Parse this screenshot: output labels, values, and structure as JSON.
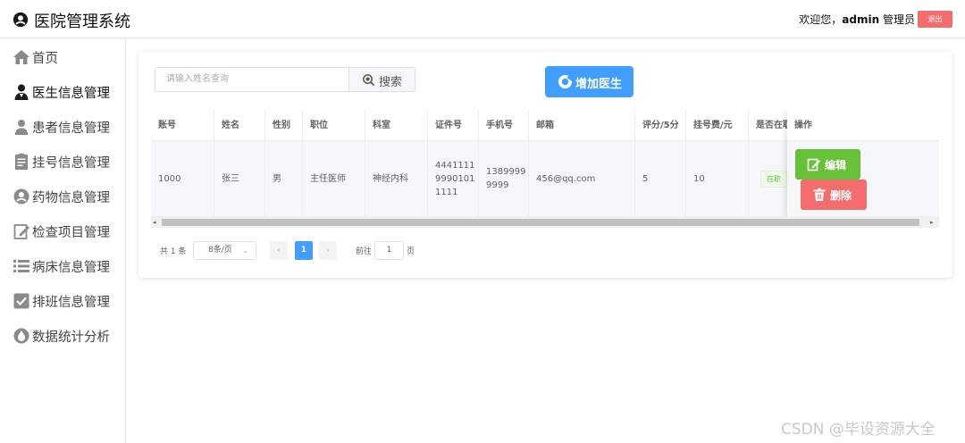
{
  "header": {
    "app_title": "医院管理系统",
    "welcome_prefix": "欢迎您，",
    "username": "admin",
    "role": "管理员",
    "logout_label": "退出"
  },
  "sidebar": {
    "items": [
      {
        "label": "首页",
        "icon": "home-icon"
      },
      {
        "label": "医生信息管理",
        "icon": "doctor-icon"
      },
      {
        "label": "患者信息管理",
        "icon": "patient-icon"
      },
      {
        "label": "挂号信息管理",
        "icon": "registration-icon"
      },
      {
        "label": "药物信息管理",
        "icon": "medicine-icon"
      },
      {
        "label": "检查项目管理",
        "icon": "checkup-icon"
      },
      {
        "label": "病床信息管理",
        "icon": "bed-list-icon"
      },
      {
        "label": "排班信息管理",
        "icon": "schedule-check-icon"
      },
      {
        "label": "数据统计分析",
        "icon": "statistics-icon"
      }
    ],
    "active_item": "医生信息管理"
  },
  "toolbar": {
    "search_placeholder": "请输入姓名查询",
    "search_label": "搜索",
    "add_label": "增加医生"
  },
  "table": {
    "columns": [
      "账号",
      "姓名",
      "性别",
      "职位",
      "科室",
      "证件号",
      "手机号",
      "邮箱",
      "评分/5分",
      "挂号费/元",
      "是否在职",
      "操作"
    ],
    "rows": [
      {
        "account": "1000",
        "name": "张三",
        "gender": "男",
        "position": "主任医师",
        "department": "神经内科",
        "id_number_lines": [
          "4441111",
          "9990101",
          "1111"
        ],
        "phone_lines": [
          "1389999",
          "9999"
        ],
        "email": "456@qq.com",
        "rating": "5",
        "fee": "10",
        "status": "在职"
      }
    ],
    "edit_label": "编辑",
    "delete_label": "删除"
  },
  "pagination": {
    "total_text": "共 1 条",
    "page_size": "8条/页",
    "current_page": "1",
    "goto_prefix": "前往",
    "goto_value": "1",
    "goto_suffix": "页"
  },
  "watermark": "CSDN @毕设资源大全",
  "colors": {
    "primary": "#409eff",
    "success": "#67c23a",
    "danger": "#f56c6c"
  }
}
